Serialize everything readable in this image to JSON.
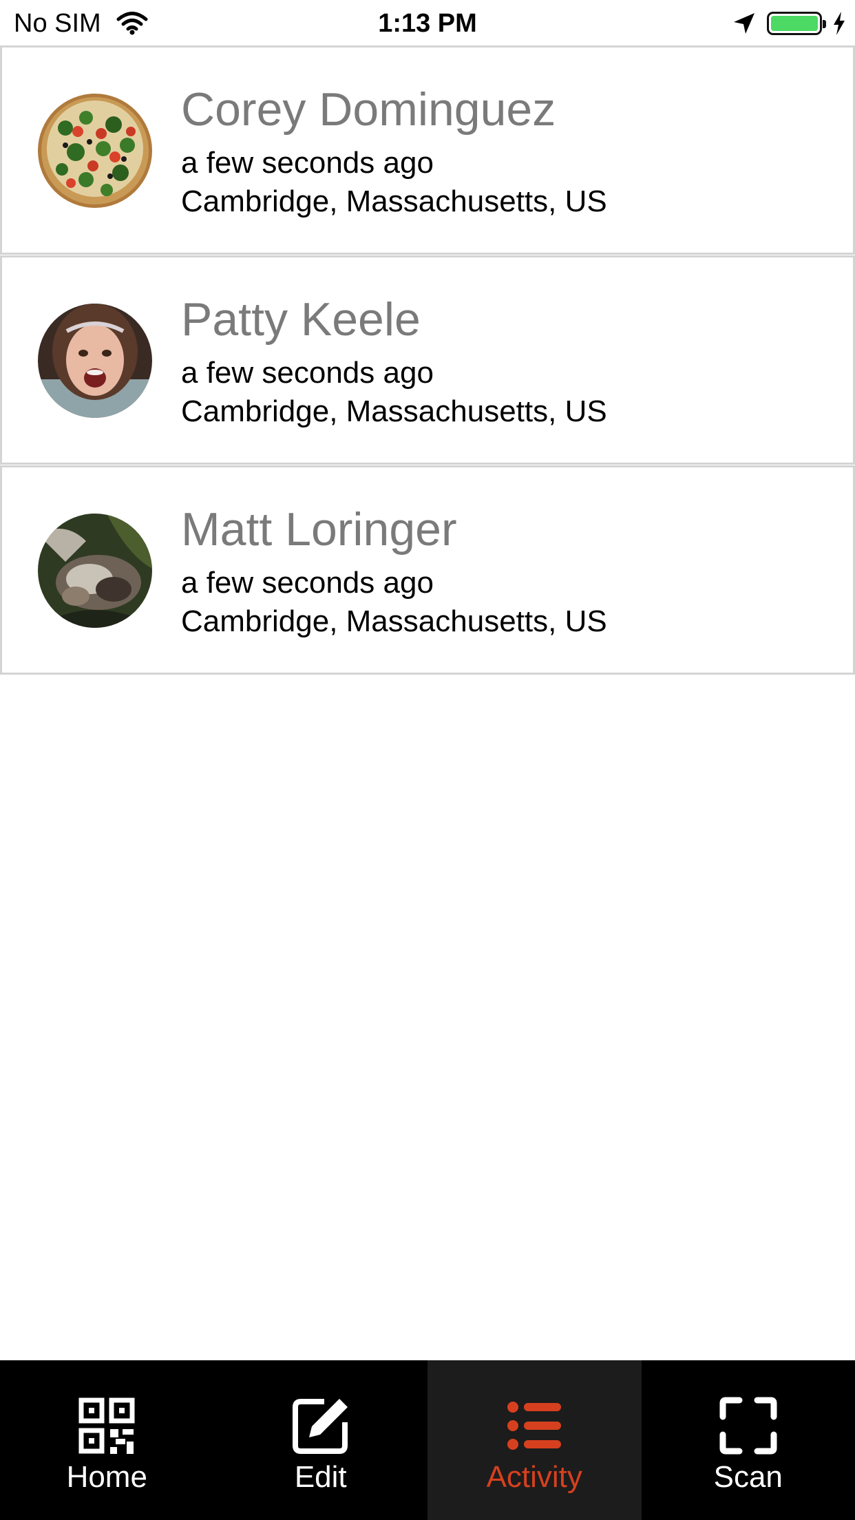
{
  "status_bar": {
    "carrier": "No SIM",
    "time": "1:13 PM",
    "battery_color": "#4cd964",
    "icons": [
      "wifi-icon",
      "location-arrow-icon",
      "battery-icon",
      "charging-bolt-icon"
    ]
  },
  "activity": {
    "items": [
      {
        "name": "Corey Dominguez",
        "time": "a few seconds ago",
        "location": "Cambridge, Massachusetts, US",
        "avatar": "pizza-photo"
      },
      {
        "name": "Patty Keele",
        "time": "a few seconds ago",
        "location": "Cambridge, Massachusetts, US",
        "avatar": "girl-photo"
      },
      {
        "name": "Matt Loringer",
        "time": "a few seconds ago",
        "location": "Cambridge, Massachusetts, US",
        "avatar": "cat-photo"
      }
    ]
  },
  "tab_bar": {
    "active_color": "#d7401f",
    "tabs": [
      {
        "label": "Home",
        "icon": "qr-code-icon",
        "active": false
      },
      {
        "label": "Edit",
        "icon": "edit-icon",
        "active": false
      },
      {
        "label": "Activity",
        "icon": "list-icon",
        "active": true
      },
      {
        "label": "Scan",
        "icon": "scan-frame-icon",
        "active": false
      }
    ]
  }
}
